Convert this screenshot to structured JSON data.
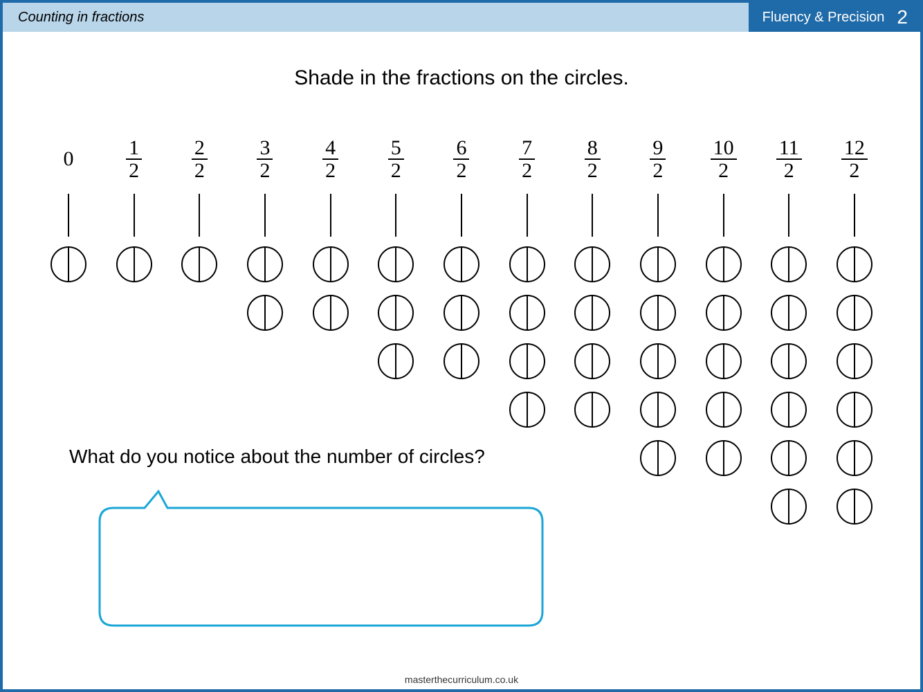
{
  "header": {
    "topic": "Counting in fractions",
    "section": "Fluency & Precision",
    "page_number": "2"
  },
  "instruction": "Shade in the fractions on the circles.",
  "columns": [
    {
      "label_type": "whole",
      "label": "0",
      "circles": 1
    },
    {
      "label_type": "frac",
      "num": "1",
      "den": "2",
      "circles": 1
    },
    {
      "label_type": "frac",
      "num": "2",
      "den": "2",
      "circles": 1
    },
    {
      "label_type": "frac",
      "num": "3",
      "den": "2",
      "circles": 2
    },
    {
      "label_type": "frac",
      "num": "4",
      "den": "2",
      "circles": 2
    },
    {
      "label_type": "frac",
      "num": "5",
      "den": "2",
      "circles": 3
    },
    {
      "label_type": "frac",
      "num": "6",
      "den": "2",
      "circles": 3
    },
    {
      "label_type": "frac",
      "num": "7",
      "den": "2",
      "circles": 4
    },
    {
      "label_type": "frac",
      "num": "8",
      "den": "2",
      "circles": 4
    },
    {
      "label_type": "frac",
      "num": "9",
      "den": "2",
      "circles": 5
    },
    {
      "label_type": "frac",
      "num": "10",
      "den": "2",
      "circles": 5
    },
    {
      "label_type": "frac",
      "num": "11",
      "den": "2",
      "circles": 6
    },
    {
      "label_type": "frac",
      "num": "12",
      "den": "2",
      "circles": 6
    }
  ],
  "question": "What do you notice about the number of circles?",
  "footer": "masterthecurriculum.co.uk",
  "colors": {
    "border": "#1f6aa8",
    "header_bg": "#b8d5ea",
    "speech_stroke": "#1aa6d6"
  }
}
